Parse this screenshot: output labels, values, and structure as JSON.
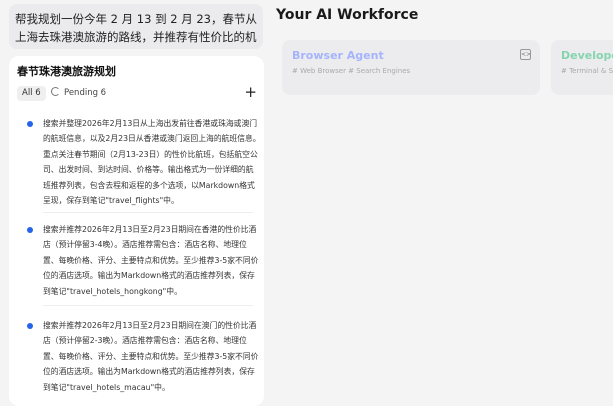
{
  "prompt": "帮我规划一份今年 2 月 13 到 2 月 23，春节从上海去珠港澳旅游的路线，并推荐有性价比的机酒。",
  "plan": {
    "title": "春节珠港澳旅游规划",
    "filter_all": "All 6",
    "filter_pending": "Pending 6",
    "add_symbol": "+",
    "tasks": [
      {
        "text": "搜索并整理2026年2月13日从上海出发前往香港或珠海或澳门的航班信息，以及2月23日从香港或澳门返回上海的航班信息。重点关注春节期间（2月13-23日）的性价比航班，包括航空公司、出发时间、到达时间、价格等。输出格式为一份详细的航班推荐列表，包含去程和返程的多个选项，以Markdown格式呈现，保存到笔记\"travel_flights\"中。"
      },
      {
        "text": "搜索并推荐2026年2月13日至2月23日期间在香港的性价比酒店（预计停留3-4晚）。酒店推荐需包含：酒店名称、地理位置、每晚价格、评分、主要特点和优势。至少推荐3-5家不同价位的酒店选项。输出为Markdown格式的酒店推荐列表，保存到笔记\"travel_hotels_hongkong\"中。"
      },
      {
        "text": "搜索并推荐2026年2月13日至2月23日期间在澳门的性价比酒店（预计停留2-3晚）。酒店推荐需包含：酒店名称、地理位置、每晚价格、评分、主要特点和优势。至少推荐3-5家不同价位的酒店选项。输出为Markdown格式的酒店推荐列表，保存到笔记\"travel_hotels_macau\"中。"
      }
    ]
  },
  "main": {
    "title": "Your AI Workforce",
    "agents": [
      {
        "name": "Browser Agent",
        "tags": "# Web Browser # Search Engines",
        "color": "#a5b4fc"
      },
      {
        "name": "Developer Agent",
        "tags": "# Terminal & Shell",
        "color": "#86d3b0"
      }
    ]
  }
}
